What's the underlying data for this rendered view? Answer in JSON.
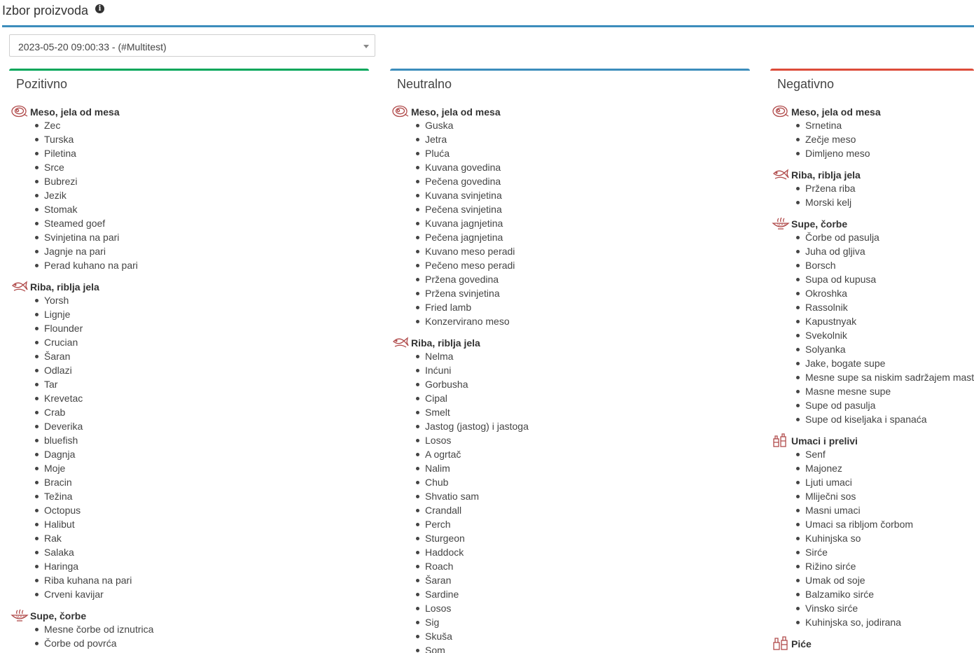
{
  "header": {
    "title": "Izbor proizvoda",
    "info_icon": "info-circle-icon"
  },
  "selector": {
    "value": "2023-05-20 09:00:33 - (#Multitest)"
  },
  "colors": {
    "header_line": "#3c8dbc",
    "positive": "#00a65a",
    "neutral": "#3c8dbc",
    "negative": "#dd4b39",
    "icon": "#b04a4a"
  },
  "columns": {
    "positive": {
      "title": "Pozitivno",
      "groups": [
        {
          "name": "Meso, jela od mesa",
          "icon": "meat-icon",
          "items": [
            "Zec",
            "Turska",
            "Piletina",
            "Srce",
            "Bubrezi",
            "Jezik",
            "Stomak",
            "Steamed goef",
            "Svinjetina na pari",
            "Jagnje na pari",
            "Perad kuhano na pari"
          ]
        },
        {
          "name": "Riba, riblja jela",
          "icon": "fish-icon",
          "items": [
            "Yorsh",
            "Lignje",
            "Flounder",
            "Crucian",
            "Šaran",
            "Odlazi",
            "Tar",
            "Krevetac",
            "Crab",
            "Deverika",
            "bluefish",
            "Dagnja",
            "Moje",
            "Bracin",
            "Težina",
            "Octopus",
            "Halibut",
            "Rak",
            "Salaka",
            "Haringa",
            "Riba kuhana na pari",
            "Crveni kavijar"
          ]
        },
        {
          "name": "Supe, čorbe",
          "icon": "soup-icon",
          "items": [
            "Mesne čorbe od iznutrica",
            "Čorbe od povrća"
          ]
        }
      ]
    },
    "neutral": {
      "title": "Neutralno",
      "groups": [
        {
          "name": "Meso, jela od mesa",
          "icon": "meat-icon",
          "items": [
            "Guska",
            "Jetra",
            "Pluća",
            "Kuvana govedina",
            "Pečena govedina",
            "Kuvana svinjetina",
            "Pečena svinjetina",
            "Kuvana jagnjetina",
            "Pečena jagnjetina",
            "Kuvano meso peradi",
            "Pečeno meso peradi",
            "Pržena govedina",
            "Pržena svinjetina",
            "Fried lamb",
            "Konzervirano meso"
          ]
        },
        {
          "name": "Riba, riblja jela",
          "icon": "fish-icon",
          "items": [
            "Nelma",
            "Inćuni",
            "Gorbusha",
            "Cipal",
            "Smelt",
            "Jastog (jastog) i jastoga",
            "Losos",
            "A ogrtač",
            "Nalim",
            "Chub",
            "Shvatio sam",
            "Crandall",
            "Perch",
            "Sturgeon",
            "Haddock",
            "Roach",
            "Šaran",
            "Sardine",
            "Losos",
            "Sig",
            "Skuša",
            "Som"
          ]
        }
      ]
    },
    "negative": {
      "title": "Negativno",
      "groups": [
        {
          "name": "Meso, jela od mesa",
          "icon": "meat-icon",
          "items": [
            "Srnetina",
            "Zečje meso",
            "Dimljeno meso"
          ]
        },
        {
          "name": "Riba, riblja jela",
          "icon": "fish-icon",
          "items": [
            "Pržena riba",
            "Morski kelj"
          ]
        },
        {
          "name": "Supe, čorbe",
          "icon": "soup-icon",
          "items": [
            "Čorbe od pasulja",
            "Juha od gljiva",
            "Borsch",
            "Supa od kupusa",
            "Okroshka",
            "Rassolnik",
            "Kapustnyak",
            "Svekolnik",
            "Solyanka",
            "Jake, bogate supe",
            "Mesne supe sa niskim sadržajem masti",
            "Masne mesne supe",
            "Supe od pasulja",
            "Supe od kiseljaka i spanaća"
          ]
        },
        {
          "name": "Umaci i prelivi",
          "icon": "sauce-bottles-icon",
          "items": [
            "Senf",
            "Majonez",
            "Ljuti umaci",
            "Mliječni sos",
            "Masni umaci",
            "Umaci sa ribljom čorbom",
            "Kuhinjska so",
            "Sirće",
            "Rižino sirće",
            "Umak od soje",
            "Balzamiko sirće",
            "Vinsko sirće",
            "Kuhinjska so, jodirana"
          ]
        },
        {
          "name": "Piće",
          "icon": "drink-bottles-icon",
          "items": []
        }
      ]
    }
  }
}
